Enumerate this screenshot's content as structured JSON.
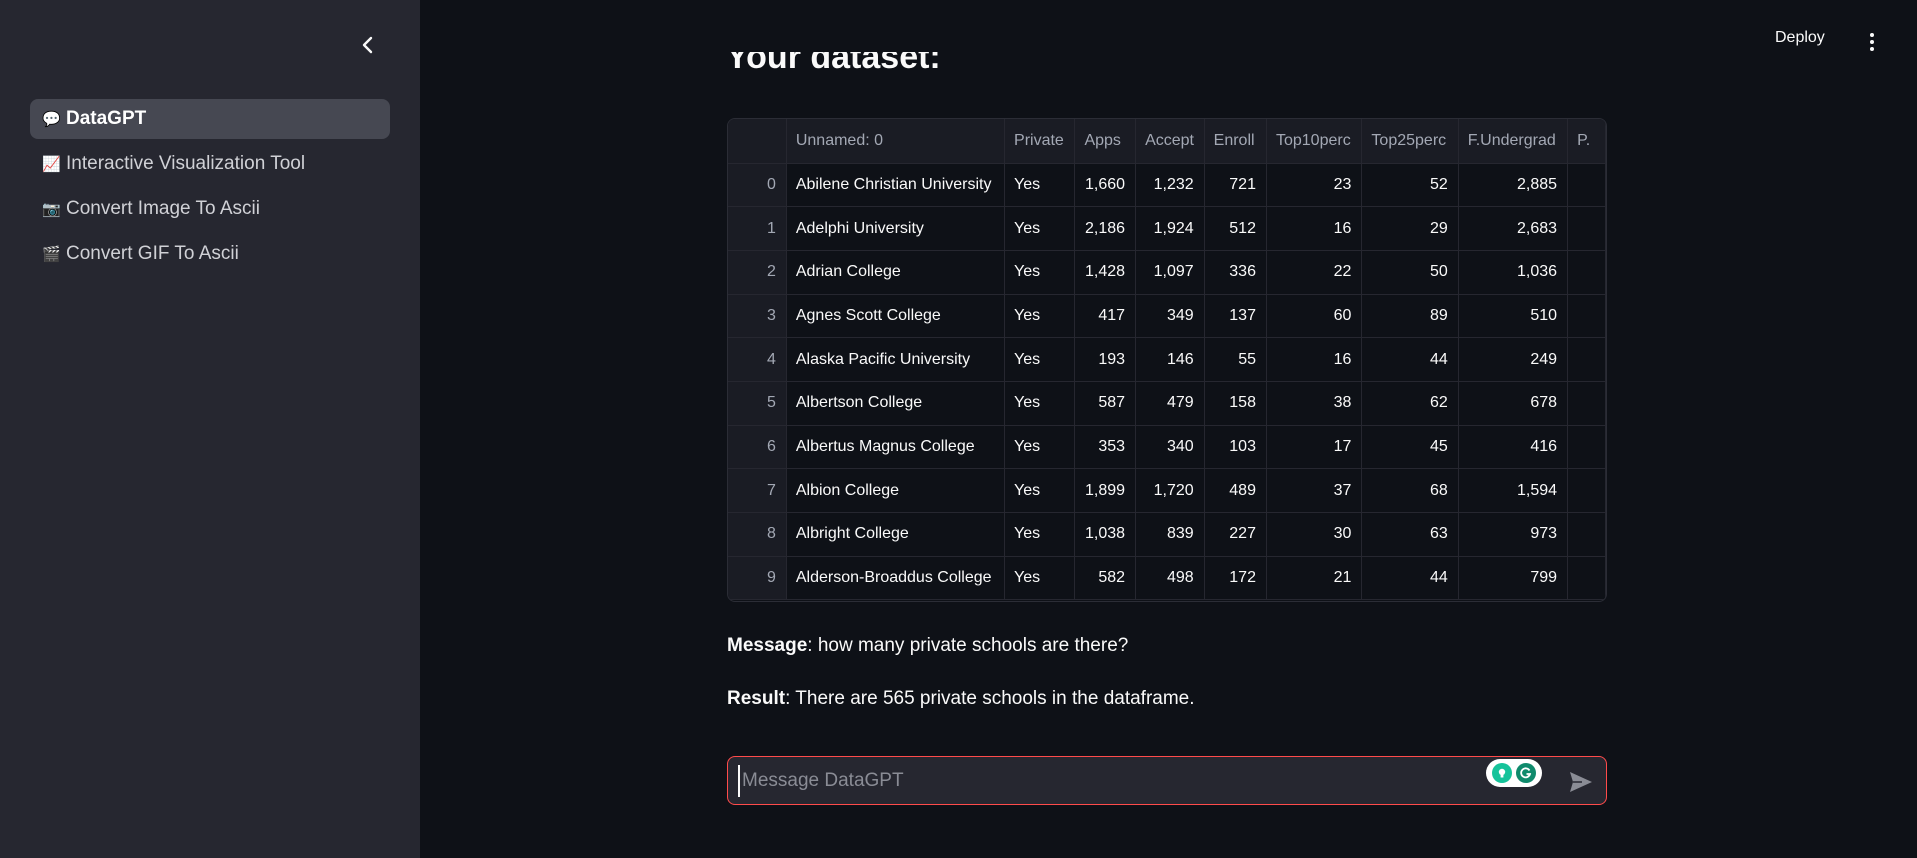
{
  "sidebar": {
    "items": [
      {
        "emoji": "💬",
        "label": "DataGPT",
        "active": true
      },
      {
        "emoji": "📈",
        "label": "Interactive Visualization Tool",
        "active": false
      },
      {
        "emoji": "📷",
        "label": "Convert Image To Ascii",
        "active": false
      },
      {
        "emoji": "🎬",
        "label": "Convert GIF To Ascii",
        "active": false
      }
    ]
  },
  "header": {
    "deploy_label": "Deploy"
  },
  "main": {
    "heading": "Your dataset:",
    "table": {
      "columns": [
        "",
        "Unnamed: 0",
        "Private",
        "Apps",
        "Accept",
        "Enroll",
        "Top10perc",
        "Top25perc",
        "F.Undergrad",
        "P."
      ],
      "rows": [
        [
          "0",
          "Abilene Christian University",
          "Yes",
          "1,660",
          "1,232",
          "721",
          "23",
          "52",
          "2,885",
          ""
        ],
        [
          "1",
          "Adelphi University",
          "Yes",
          "2,186",
          "1,924",
          "512",
          "16",
          "29",
          "2,683",
          ""
        ],
        [
          "2",
          "Adrian College",
          "Yes",
          "1,428",
          "1,097",
          "336",
          "22",
          "50",
          "1,036",
          ""
        ],
        [
          "3",
          "Agnes Scott College",
          "Yes",
          "417",
          "349",
          "137",
          "60",
          "89",
          "510",
          ""
        ],
        [
          "4",
          "Alaska Pacific University",
          "Yes",
          "193",
          "146",
          "55",
          "16",
          "44",
          "249",
          ""
        ],
        [
          "5",
          "Albertson College",
          "Yes",
          "587",
          "479",
          "158",
          "38",
          "62",
          "678",
          ""
        ],
        [
          "6",
          "Albertus Magnus College",
          "Yes",
          "353",
          "340",
          "103",
          "17",
          "45",
          "416",
          ""
        ],
        [
          "7",
          "Albion College",
          "Yes",
          "1,899",
          "1,720",
          "489",
          "37",
          "68",
          "1,594",
          ""
        ],
        [
          "8",
          "Albright College",
          "Yes",
          "1,038",
          "839",
          "227",
          "30",
          "63",
          "973",
          ""
        ],
        [
          "9",
          "Alderson-Broaddus College",
          "Yes",
          "582",
          "498",
          "172",
          "21",
          "44",
          "799",
          ""
        ]
      ]
    },
    "message": {
      "label": "Message",
      "text": ": how many private schools are there?"
    },
    "result": {
      "label": "Result",
      "text": ": There are 565 private schools in the dataframe."
    },
    "chat": {
      "placeholder": "Message DataGPT"
    }
  },
  "colors": {
    "background": "#0e1117",
    "sidebar": "#262730",
    "accent": "#ff4b4b"
  }
}
